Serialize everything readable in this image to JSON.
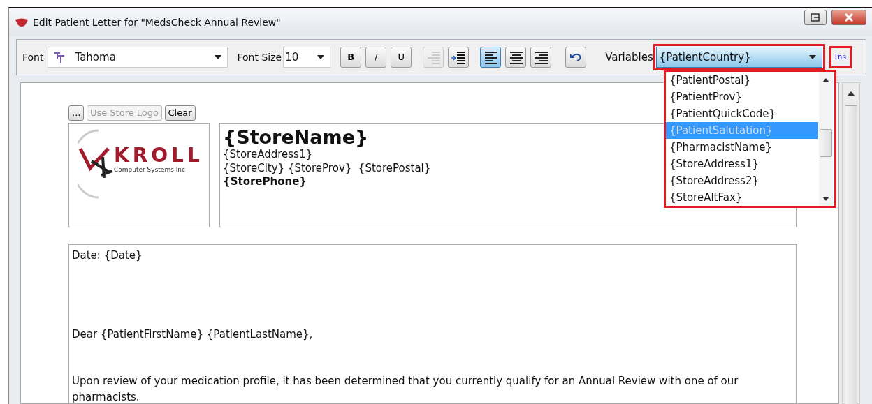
{
  "window": {
    "title": "Edit Patient Letter for \"MedsCheck Annual Review\""
  },
  "toolbar": {
    "font": {
      "label": "Font",
      "value": "Tahoma"
    },
    "font_size": {
      "label": "Font Size",
      "value": "10"
    },
    "style_buttons": [
      {
        "kind": "bold",
        "label": "B"
      },
      {
        "kind": "italic",
        "label": "/"
      },
      {
        "kind": "underline",
        "label": "U"
      }
    ],
    "indent_buttons": [
      {
        "kind": "outdent",
        "disabled": true
      },
      {
        "kind": "indent",
        "disabled": false
      }
    ],
    "align_buttons": [
      {
        "kind": "left",
        "selected": true
      },
      {
        "kind": "center",
        "selected": false
      },
      {
        "kind": "right",
        "selected": false
      }
    ],
    "variables": {
      "label": "Variables",
      "value": "{PatientCountry}",
      "insert_label": "Ins",
      "items": [
        {
          "text": "{PatientPostal}",
          "selected": false
        },
        {
          "text": "{PatientProv}",
          "selected": false
        },
        {
          "text": "{PatientQuickCode}",
          "selected": false
        },
        {
          "text": "{PatientSalutation}",
          "selected": true
        },
        {
          "text": "{PharmacistName}",
          "selected": false
        },
        {
          "text": "{StoreAddress1}",
          "selected": false
        },
        {
          "text": "{StoreAddress2}",
          "selected": false
        },
        {
          "text": "{StoreAltFax}",
          "selected": false
        }
      ]
    }
  },
  "logo_buttons": [
    {
      "label": "...",
      "disabled": false
    },
    {
      "label": "Use Store Logo",
      "disabled": true
    },
    {
      "label": "Clear",
      "disabled": false
    }
  ],
  "logo": {
    "wordmark": "KROLL",
    "tagline": "Computer Systems Inc"
  },
  "header_lines": [
    {
      "kind": "title",
      "text": "{StoreName}"
    },
    {
      "kind": "normal",
      "text": "{StoreAddress1}"
    },
    {
      "kind": "normal",
      "text": "{StoreCity} {StoreProv}  {StorePostal}"
    },
    {
      "kind": "bold",
      "text": "{StorePhone}"
    }
  ],
  "body_paragraphs": [
    "Date: {Date}",
    "Dear {PatientFirstName} {PatientLastName},",
    "Upon review of your medication profile, it has been determined that you currently qualify for an Annual Review with one of our pharmacists."
  ]
}
